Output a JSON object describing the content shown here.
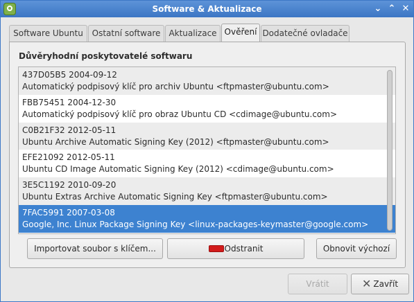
{
  "window": {
    "title": "Software & Aktualizace",
    "minimize_glyph": "⌄",
    "maximize_glyph": "⌃",
    "close_glyph": "✕"
  },
  "tabs": [
    {
      "label": "Software Ubuntu",
      "active": false
    },
    {
      "label": "Ostatní software",
      "active": false
    },
    {
      "label": "Aktualizace",
      "active": false
    },
    {
      "label": "Ověření",
      "active": true
    },
    {
      "label": "Dodatečné ovladače",
      "active": false
    }
  ],
  "authentication": {
    "heading": "Důvěryhodní poskytovatelé softwaru",
    "keys": [
      {
        "id_date": "437D05B5 2004-09-12",
        "description": "Automatický podpisový klíč pro archiv Ubuntu <ftpmaster@ubuntu.com>",
        "selected": false
      },
      {
        "id_date": "FBB75451 2004-12-30",
        "description": "Automatický podpisový klíč pro obraz Ubuntu CD <cdimage@ubuntu.com>",
        "selected": false
      },
      {
        "id_date": "C0B21F32 2012-05-11",
        "description": "Ubuntu Archive Automatic Signing Key (2012) <ftpmaster@ubuntu.com>",
        "selected": false
      },
      {
        "id_date": "EFE21092 2012-05-11",
        "description": "Ubuntu CD Image Automatic Signing Key (2012) <cdimage@ubuntu.com>",
        "selected": false
      },
      {
        "id_date": "3E5C1192 2010-09-20",
        "description": "Ubuntu Extras Archive Automatic Signing Key <ftpmaster@ubuntu.com>",
        "selected": false
      },
      {
        "id_date": "7FAC5991 2007-03-08",
        "description": "Google, Inc. Linux Package Signing Key <linux-packages-keymaster@google.com>",
        "selected": true
      }
    ],
    "buttons": {
      "import": "Importovat soubor s klíčem...",
      "remove": "Odstranit",
      "restore": "Obnovit výchozí"
    }
  },
  "footer": {
    "revert": "Vrátit",
    "close": "Zavřít"
  },
  "colors": {
    "selection": "#3d82d0",
    "titlebar": "#4a84cf",
    "remove_icon": "#d21b1b"
  }
}
